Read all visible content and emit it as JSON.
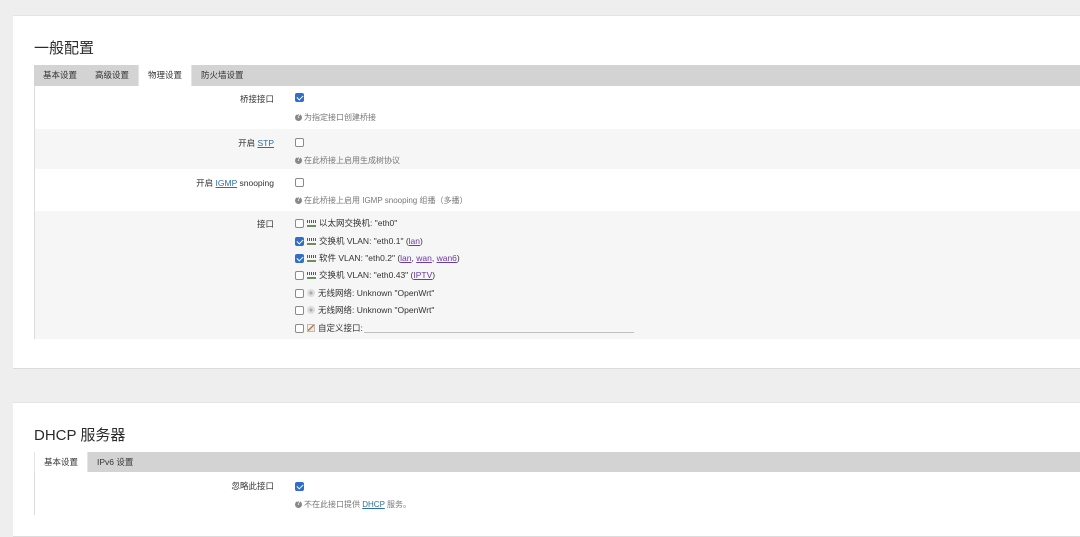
{
  "general": {
    "title": "一般配置",
    "tabs": [
      "基本设置",
      "高级设置",
      "物理设置",
      "防火墙设置"
    ],
    "active_tab": "物理设置",
    "bridge": {
      "label": "桥接接口",
      "checked": true,
      "help": "为指定接口创建桥接"
    },
    "stp": {
      "label_prefix": "开启",
      "label_link": "STP",
      "checked": false,
      "help": "在此桥接上启用生成树协议"
    },
    "igmp": {
      "label_prefix": "开启",
      "label_link": "IGMP",
      "label_suffix": "snooping",
      "checked": false,
      "help": "在此桥接上启用 IGMP snooping 组播（多播）"
    },
    "interfaces": {
      "label": "接口",
      "items": [
        {
          "checked": false,
          "icon": "ethernet-switch-icon",
          "text": "以太网交换机: \"eth0\"",
          "nets": []
        },
        {
          "checked": true,
          "icon": "ethernet-switch-icon",
          "text": "交换机 VLAN: \"eth0.1\"",
          "nets": [
            "lan"
          ]
        },
        {
          "checked": true,
          "icon": "ethernet-switch-icon",
          "text": "软件 VLAN: \"eth0.2\"",
          "nets": [
            "lan",
            "wan",
            "wan6"
          ]
        },
        {
          "checked": false,
          "icon": "ethernet-switch-icon",
          "text": "交换机 VLAN: \"eth0.43\"",
          "nets": [
            "IPTV"
          ]
        },
        {
          "checked": false,
          "icon": "wireless-icon",
          "text": "无线网络: Unknown \"OpenWrt\"",
          "nets": []
        },
        {
          "checked": false,
          "icon": "wireless-icon",
          "text": "无线网络: Unknown \"OpenWrt\"",
          "nets": []
        }
      ],
      "custom_label": "自定义接口:",
      "custom_value": ""
    }
  },
  "dhcp": {
    "title": "DHCP 服务器",
    "tabs": [
      "基本设置",
      "IPv6 设置"
    ],
    "active_tab": "基本设置",
    "ignore": {
      "label": "忽略此接口",
      "checked": true,
      "help_prefix": "不在此接口提供",
      "help_link": "DHCP",
      "help_suffix": "服务。"
    }
  },
  "colors": {
    "checkbox_checked": "#2f6fc7",
    "link": "#2c6fa3",
    "tabbar": "#d3d3d3"
  }
}
